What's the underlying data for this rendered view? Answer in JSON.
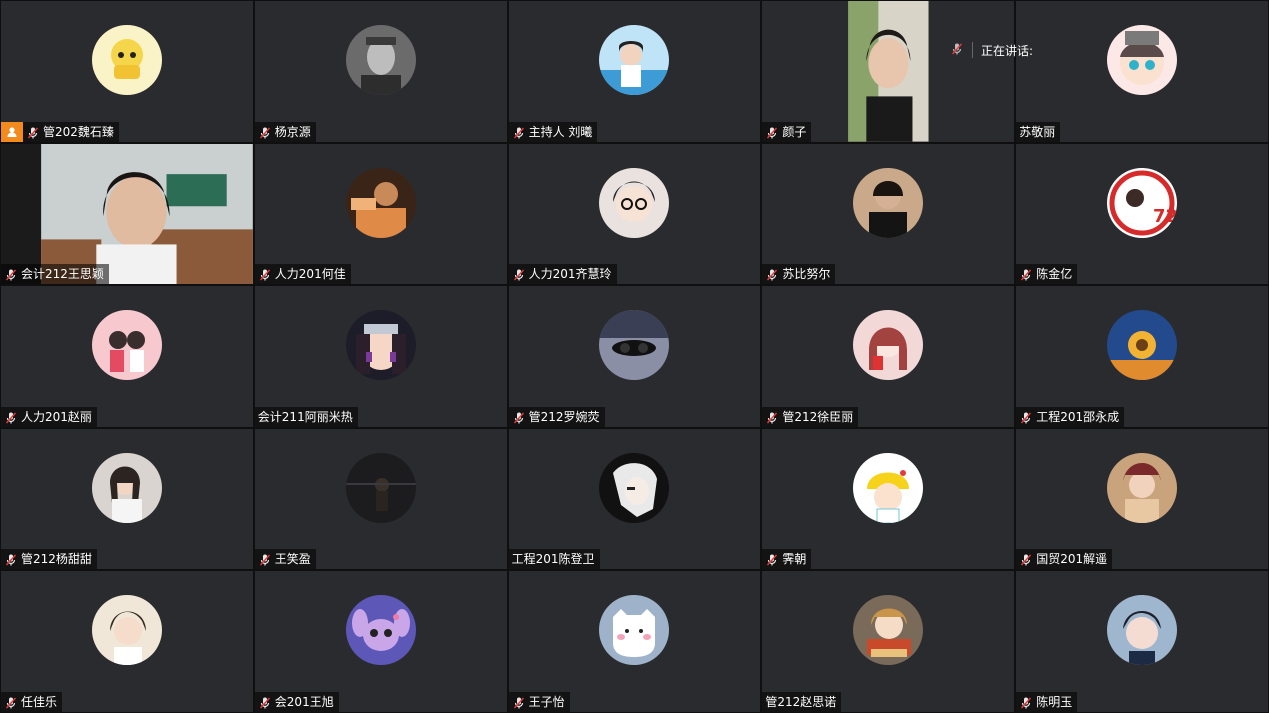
{
  "speaking_indicator": {
    "label": "正在讲话:"
  },
  "participants": [
    {
      "name": "管202魏石臻"
    },
    {
      "name": "杨京源"
    },
    {
      "name": "主持人 刘曦"
    },
    {
      "name": "颜子"
    },
    {
      "name": "苏敬丽"
    },
    {
      "name": "会计212王思颖"
    },
    {
      "name": "人力201何佳"
    },
    {
      "name": "人力201齐慧玲"
    },
    {
      "name": "苏比努尔"
    },
    {
      "name": "陈金亿"
    },
    {
      "name": "人力201赵丽"
    },
    {
      "name": "会计211阿丽米热"
    },
    {
      "name": "管212罗婉荧"
    },
    {
      "name": "管212徐臣丽"
    },
    {
      "name": "工程201邵永成"
    },
    {
      "name": "管212杨甜甜"
    },
    {
      "name": "王笑盈"
    },
    {
      "name": "工程201陈登卫"
    },
    {
      "name": "霁朝"
    },
    {
      "name": "国贸201解遥"
    },
    {
      "name": "任佳乐"
    },
    {
      "name": "会201王旭"
    },
    {
      "name": "王子怡"
    },
    {
      "name": "管212赵思诺"
    },
    {
      "name": "陈明玉"
    }
  ],
  "colors": {
    "tile_bg": "#2a2b2e",
    "host_badge": "#f28a1e",
    "mic_red": "#e23b3b"
  }
}
